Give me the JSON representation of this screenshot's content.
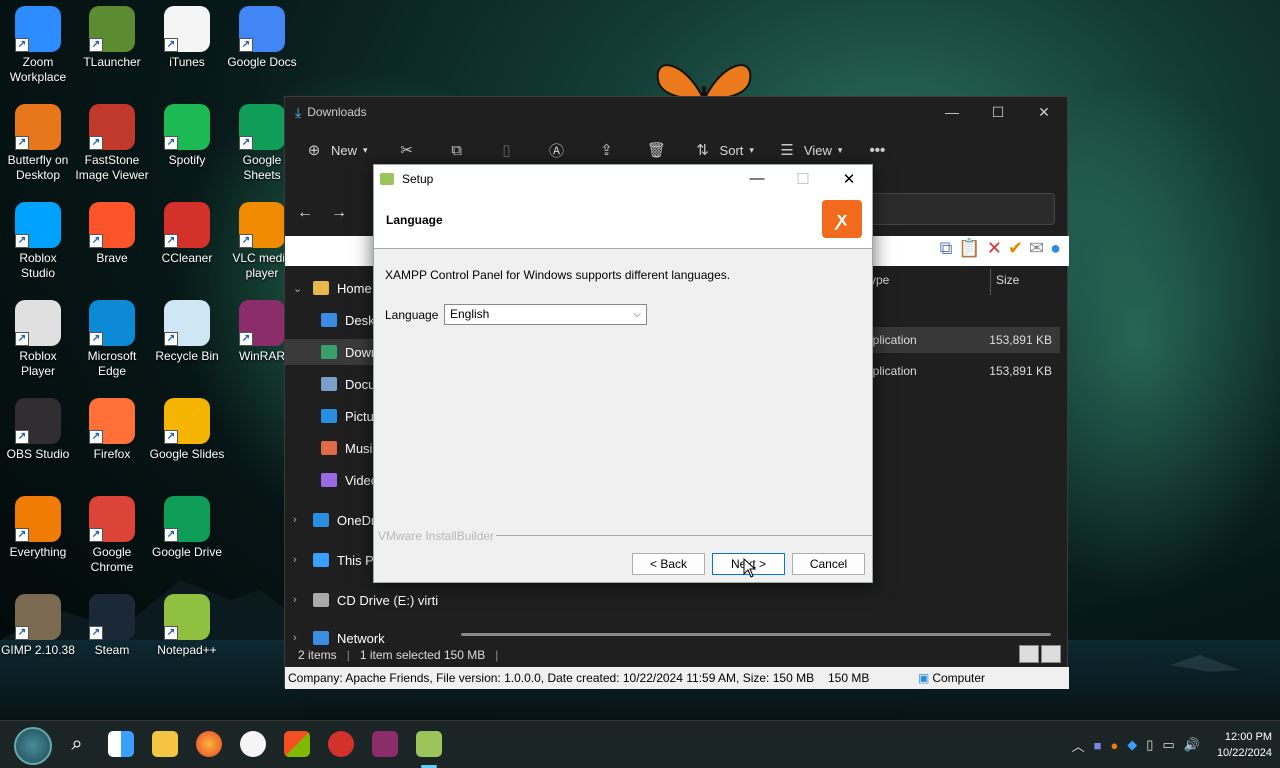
{
  "desktop": {
    "icons": [
      {
        "label": "Zoom\nWorkplace",
        "icon": "zoom-icon",
        "color": "#2d8cff"
      },
      {
        "label": "TLauncher",
        "icon": "minecraft-icon",
        "color": "#5b8c32"
      },
      {
        "label": "iTunes",
        "icon": "itunes-icon",
        "color": "#f5f5f5"
      },
      {
        "label": "Google Docs",
        "icon": "google-docs-icon",
        "color": "#4285f4"
      },
      {
        "label": "Butterfly on\nDesktop",
        "icon": "butterfly-icon",
        "color": "#e8761a"
      },
      {
        "label": "FastStone\nImage Viewer",
        "icon": "faststone-icon",
        "color": "#c0392b"
      },
      {
        "label": "Spotify",
        "icon": "spotify-icon",
        "color": "#1db954"
      },
      {
        "label": "Google\nSheets",
        "icon": "google-sheets-icon",
        "color": "#0f9d58"
      },
      {
        "label": "Roblox\nStudio",
        "icon": "roblox-studio-icon",
        "color": "#00a2ff"
      },
      {
        "label": "Brave",
        "icon": "brave-icon",
        "color": "#fb542b"
      },
      {
        "label": "CCleaner",
        "icon": "ccleaner-icon",
        "color": "#d4312a"
      },
      {
        "label": "VLC media\nplayer",
        "icon": "vlc-icon",
        "color": "#f08a00"
      },
      {
        "label": "Roblox\nPlayer",
        "icon": "roblox-player-icon",
        "color": "#e0e0e0"
      },
      {
        "label": "Microsoft\nEdge",
        "icon": "edge-icon",
        "color": "#0c8ad6"
      },
      {
        "label": "Recycle Bin",
        "icon": "recycle-bin-icon",
        "color": "#cfe6f5"
      },
      {
        "label": "WinRAR",
        "icon": "winrar-icon",
        "color": "#8b2c6b"
      },
      {
        "label": "OBS Studio",
        "icon": "obs-icon",
        "color": "#302e31"
      },
      {
        "label": "Firefox",
        "icon": "firefox-icon",
        "color": "#ff7139"
      },
      {
        "label": "Google Slides",
        "icon": "google-slides-icon",
        "color": "#f4b400"
      },
      {
        "label": "Everything",
        "icon": "everything-icon",
        "color": "#f07b05"
      },
      {
        "label": "Google\nChrome",
        "icon": "chrome-icon",
        "color": "#db4437"
      },
      {
        "label": "Google Drive",
        "icon": "google-drive-icon",
        "color": "#0f9d58"
      },
      {
        "label": "GIMP 2.10.38",
        "icon": "gimp-icon",
        "color": "#7a6a52"
      },
      {
        "label": "Steam",
        "icon": "steam-icon",
        "color": "#1b2838"
      },
      {
        "label": "Notepad++",
        "icon": "notepadpp-icon",
        "color": "#90c040"
      }
    ]
  },
  "explorer": {
    "title": "Downloads",
    "toolbar": {
      "new": "New",
      "sort": "Sort",
      "view": "View",
      "more": "•••"
    },
    "sidebar": [
      {
        "label": "Home",
        "chev": "⌄"
      },
      {
        "label": "Deskt",
        "chev": ""
      },
      {
        "label": "Down",
        "chev": ""
      },
      {
        "label": "Docu",
        "chev": ""
      },
      {
        "label": "Pictur",
        "chev": ""
      },
      {
        "label": "Music",
        "chev": ""
      },
      {
        "label": "Video",
        "chev": ""
      },
      {
        "label": "OneDri",
        "chev": "›"
      },
      {
        "label": "This PC",
        "chev": "›"
      },
      {
        "label": "CD Drive (E:) virti",
        "chev": "›"
      },
      {
        "label": "Network",
        "chev": "›"
      }
    ],
    "columns": {
      "type": "ype",
      "size": "Size"
    },
    "files": [
      {
        "type": "Application",
        "size": "153,891 KB"
      },
      {
        "type": "Application",
        "size": "153,891 KB"
      }
    ],
    "status": {
      "count": "2 items",
      "selected": "1 item selected  150 MB"
    },
    "info": {
      "details": "Company: Apache Friends, File version: 1.0.0.0, Date created: 10/22/2024 11:59 AM, Size: 150 MB",
      "size": "150 MB",
      "location": "Computer"
    }
  },
  "setup": {
    "title": "Setup",
    "header": "Language",
    "logo": "ꭗ",
    "description": "XAMPP Control Panel for Windows supports different languages.",
    "language_label": "Language",
    "language_value": "English",
    "brand": "VMware InstallBuilder",
    "buttons": {
      "back": "< Back",
      "next": "Next >",
      "cancel": "Cancel"
    }
  },
  "taskbar": {
    "clock_time": "12:00 PM",
    "clock_date": "10/22/2024"
  },
  "colors": {
    "accent": "#60cdff",
    "xampp": "#f26b1d",
    "butterfly": "#e8761a"
  }
}
